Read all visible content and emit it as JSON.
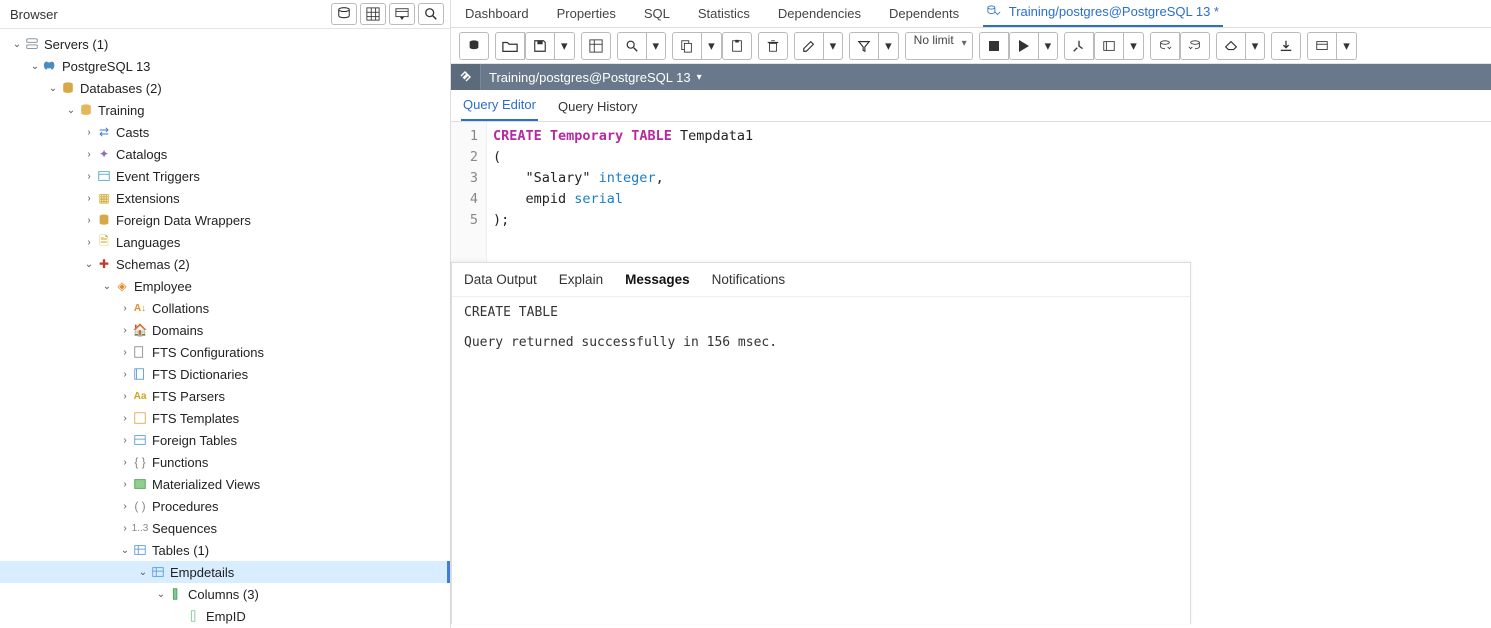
{
  "sidebar": {
    "title": "Browser",
    "header_buttons": [
      "database-icon",
      "grid-icon",
      "filter-icon",
      "search-icon"
    ],
    "tree": [
      {
        "depth": 0,
        "tw": "v",
        "icon": "servers",
        "label": "Servers (1)"
      },
      {
        "depth": 1,
        "tw": "v",
        "icon": "elephant",
        "label": "PostgreSQL 13"
      },
      {
        "depth": 2,
        "tw": "v",
        "icon": "db",
        "label": "Databases (2)"
      },
      {
        "depth": 3,
        "tw": "v",
        "icon": "db-gold",
        "label": "Training"
      },
      {
        "depth": 4,
        "tw": ">",
        "icon": "casts",
        "label": "Casts"
      },
      {
        "depth": 4,
        "tw": ">",
        "icon": "catalogs",
        "label": "Catalogs"
      },
      {
        "depth": 4,
        "tw": ">",
        "icon": "event",
        "label": "Event Triggers"
      },
      {
        "depth": 4,
        "tw": ">",
        "icon": "ext",
        "label": "Extensions"
      },
      {
        "depth": 4,
        "tw": ">",
        "icon": "fdw",
        "label": "Foreign Data Wrappers"
      },
      {
        "depth": 4,
        "tw": ">",
        "icon": "lang",
        "label": "Languages"
      },
      {
        "depth": 4,
        "tw": "v",
        "icon": "schemas",
        "label": "Schemas (2)"
      },
      {
        "depth": 5,
        "tw": "v",
        "icon": "schema",
        "label": "Employee"
      },
      {
        "depth": 6,
        "tw": ">",
        "icon": "coll",
        "label": "Collations"
      },
      {
        "depth": 6,
        "tw": ">",
        "icon": "domain",
        "label": "Domains"
      },
      {
        "depth": 6,
        "tw": ">",
        "icon": "ftsconf",
        "label": "FTS Configurations"
      },
      {
        "depth": 6,
        "tw": ">",
        "icon": "ftsdict",
        "label": "FTS Dictionaries"
      },
      {
        "depth": 6,
        "tw": ">",
        "icon": "ftspars",
        "label": "FTS Parsers"
      },
      {
        "depth": 6,
        "tw": ">",
        "icon": "ftstmpl",
        "label": "FTS Templates"
      },
      {
        "depth": 6,
        "tw": ">",
        "icon": "ftable",
        "label": "Foreign Tables"
      },
      {
        "depth": 6,
        "tw": ">",
        "icon": "func",
        "label": "Functions"
      },
      {
        "depth": 6,
        "tw": ">",
        "icon": "mview",
        "label": "Materialized Views"
      },
      {
        "depth": 6,
        "tw": ">",
        "icon": "proc",
        "label": "Procedures"
      },
      {
        "depth": 6,
        "tw": ">",
        "icon": "seq",
        "label": "Sequences"
      },
      {
        "depth": 6,
        "tw": "v",
        "icon": "tables",
        "label": "Tables (1)"
      },
      {
        "depth": 7,
        "tw": "v",
        "icon": "table",
        "label": "Empdetails",
        "selected": true
      },
      {
        "depth": 8,
        "tw": "v",
        "icon": "columns",
        "label": "Columns (3)"
      },
      {
        "depth": 9,
        "tw": "",
        "icon": "column",
        "label": "EmpID"
      }
    ]
  },
  "top_tabs": {
    "items": [
      "Dashboard",
      "Properties",
      "SQL",
      "Statistics",
      "Dependencies",
      "Dependents"
    ],
    "active": {
      "icon": "query-tool",
      "label": "Training/postgres@PostgreSQL 13 *"
    }
  },
  "toolbar": {
    "limit_label": "No limit"
  },
  "connection": {
    "label": "Training/postgres@PostgreSQL 13"
  },
  "sub_tabs": {
    "items": [
      "Query Editor",
      "Query History"
    ],
    "active_index": 0
  },
  "editor": {
    "lines": [
      {
        "n": "1",
        "tokens": [
          {
            "t": "CREATE",
            "c": "kw"
          },
          {
            "t": " "
          },
          {
            "t": "Temporary",
            "c": "kw"
          },
          {
            "t": " "
          },
          {
            "t": "TABLE",
            "c": "kw"
          },
          {
            "t": " Tempdata1"
          }
        ]
      },
      {
        "n": "2",
        "tokens": [
          {
            "t": "("
          }
        ]
      },
      {
        "n": "3",
        "tokens": [
          {
            "t": "    \"Salary\" "
          },
          {
            "t": "integer",
            "c": "typ"
          },
          {
            "t": ","
          }
        ]
      },
      {
        "n": "4",
        "tokens": [
          {
            "t": "    empid "
          },
          {
            "t": "serial",
            "c": "typ"
          }
        ]
      },
      {
        "n": "5",
        "tokens": [
          {
            "t": ");"
          }
        ]
      }
    ]
  },
  "output": {
    "tabs": [
      "Data Output",
      "Explain",
      "Messages",
      "Notifications"
    ],
    "active_index": 2,
    "body": "CREATE TABLE\n\nQuery returned successfully in 156 msec."
  }
}
